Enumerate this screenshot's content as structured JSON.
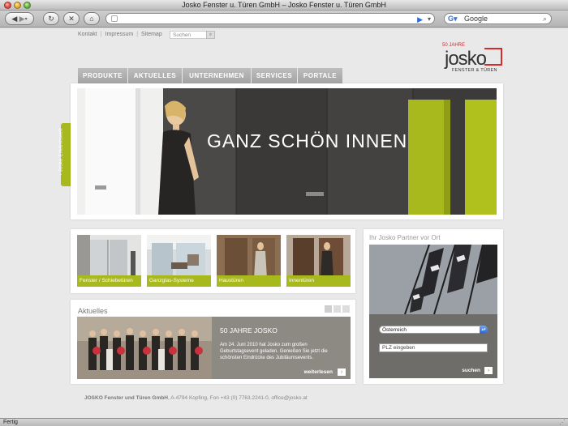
{
  "window": {
    "title": "Josko Fenster u. Türen GmbH – Josko Fenster u. Türen GmbH"
  },
  "browser": {
    "back_icon": "back-arrow-icon",
    "forward_icon": "forward-arrow-icon",
    "search_placeholder": "Google",
    "status": "Fertig"
  },
  "topnav": {
    "kontakt": "Kontakt",
    "impressum": "Impressum",
    "sitemap": "Sitemap",
    "search_placeholder": "Suchen"
  },
  "logo": {
    "badge": "50 JAHRE",
    "word": "josko",
    "subtitle": "FENSTER & TÜREN"
  },
  "mainnav": [
    "PRODUKTE",
    "AKTUELLES",
    "UNTERNEHMEN",
    "SERVICES",
    "PORTALE"
  ],
  "hero": {
    "headline": "GANZ SCHÖN INNEN"
  },
  "side_tab": {
    "label": "› Josko Erlebniswelt"
  },
  "categories": [
    {
      "label": "Fenster / Schiebetüren"
    },
    {
      "label": "Ganzglas-Systeme"
    },
    {
      "label": "Haustüren"
    },
    {
      "label": "Innentüren"
    }
  ],
  "news": {
    "section_title": "Aktuelles",
    "headline": "50 JAHRE JOSKO",
    "body": "Am 24. Juni 2010 hat Josko zum großen Geburtstagsevent geladen. Genießen Sie jetzt die schönsten Eindrücke des Jubiläumsevents.",
    "more": "weiterlesen"
  },
  "partner": {
    "title": "Ihr Josko Partner vor Ort",
    "country": "Österreich",
    "plz_placeholder": "PLZ eingeben",
    "search": "suchen"
  },
  "footer": {
    "company": "JOSKO Fenster und Türen GmbH",
    "address": ", A-4794 Kopfing, Fon +43 (0) 7763.2241-0, office@josko.at"
  },
  "colors": {
    "accent_green": "#a8b91d",
    "brand_red": "#d72a2a",
    "nav_gray": "#b0b0b0"
  }
}
